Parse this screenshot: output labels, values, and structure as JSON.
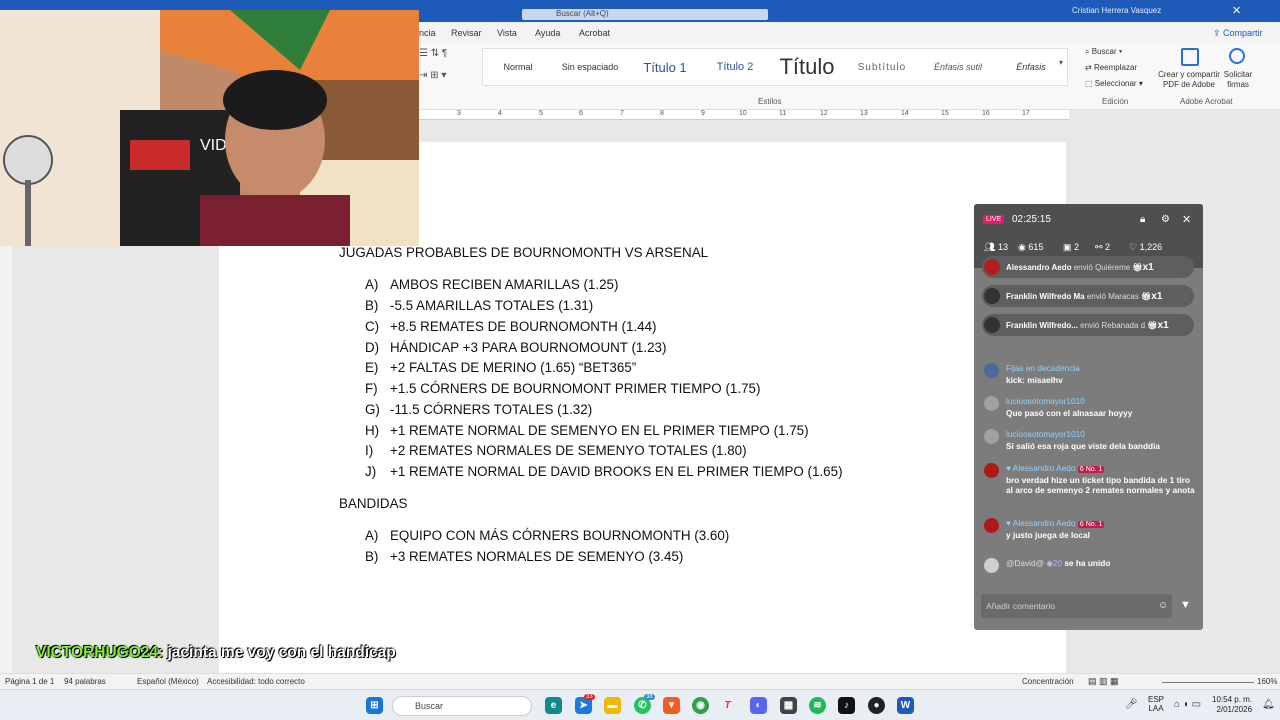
{
  "titlebar": {
    "search": "Buscar (Alt+Q)",
    "user": "Cristian Herrera Vasquez",
    "close": "✕"
  },
  "ribbon": {
    "tabs": [
      "ncia",
      "Revisar",
      "Vista",
      "Ayuda",
      "Acrobat"
    ],
    "share": "Compartir",
    "styles": [
      "Normal",
      "Sin espaciado",
      "Título 1",
      "Título 2",
      "Título",
      "Subtítulo",
      "Énfasis sutil",
      "Énfasis"
    ],
    "styles_label": "Estilos",
    "edit": {
      "find": "Buscar",
      "replace": "Reemplazar",
      "select": "Seleccionar",
      "label": "Edición"
    },
    "adobe": {
      "create": "Crear y compartir PDF de Adobe",
      "request": "Solicitar firmas",
      "label": "Adobe Acrobat"
    }
  },
  "ruler_numbers": [
    "3",
    "4",
    "5",
    "6",
    "7",
    "8",
    "9",
    "10",
    "11",
    "12",
    "13",
    "14",
    "15",
    "16",
    "17"
  ],
  "doc": {
    "heading": "JUGADAS PROBABLES DE BOURNOMONTH VS ARSENAL",
    "items": [
      {
        "letter": "A)",
        "text": "AMBOS RECIBEN AMARILLAS (1.25)"
      },
      {
        "letter": "B)",
        "text": "-5.5 AMARILLAS TOTALES (1.31)"
      },
      {
        "letter": "C)",
        "text": "+8.5 REMATES DE BOURNOMONTH (1.44)"
      },
      {
        "letter": "D)",
        "text": "HÁNDICAP +3 PARA BOURNOMOUNT (1.23)"
      },
      {
        "letter": "E)",
        "text": "+2 FALTAS DE MERINO (1.65) “BET365”"
      },
      {
        "letter": "F)",
        "text": "+1.5 CÓRNERS DE BOURNOMONT PRIMER TIEMPO (1.75)"
      },
      {
        "letter": "G)",
        "text": "-11.5 CÓRNERS TOTALES (1.32)"
      },
      {
        "letter": "H)",
        "text": "+1 REMATE NORMAL DE SEMENYO EN EL PRIMER TIEMPO (1.75)"
      },
      {
        "letter": "I)",
        "text": "+2 REMATES NORMALES DE SEMENYO TOTALES (1.80)"
      },
      {
        "letter": "J)",
        "text": "+1 REMATE NORMAL DE DAVID BROOKS EN EL PRIMER TIEMPO (1.65)"
      }
    ],
    "heading2": "BANDIDAS",
    "items2": [
      {
        "letter": "A)",
        "text": "EQUIPO CON MÁS CÓRNERS BOURNOMONTH (3.60)"
      },
      {
        "letter": "B)",
        "text": "+3 REMATES NORMALES DE SEMENYO (3.45)"
      }
    ]
  },
  "webcam": {
    "chair_text": "VID"
  },
  "live": {
    "badge": "LIVE",
    "time": "02:25:15",
    "stats": [
      "13",
      "615",
      "2",
      "2",
      "1,226"
    ],
    "gifts": [
      {
        "name": "Alessandro Aedo",
        "action": "envió Quiéreme",
        "count": "x1"
      },
      {
        "name": "Franklin Wilfredo Ma",
        "action": "envió Maracas",
        "count": "x1"
      },
      {
        "name": "Franklin Wilfredo...",
        "action": "envió Rebanada d",
        "count": "x1"
      }
    ],
    "chats": [
      {
        "name": "Fijas en decadencia",
        "msg": "kick: misaelhv"
      },
      {
        "name": "lucioosotomayor1010",
        "msg": "Que pasó con el alnasaar hoyyy"
      },
      {
        "name": "lucioosotomayor1010",
        "msg": "Si salió esa roja que viste dela banddia"
      },
      {
        "name": "Alessandro Aedo",
        "badge": "No. 1",
        "badge_num": "6",
        "msg": "bro verdad hize un ticket tipo bandida de 1 tiro al arco de semenyo 2 remates normales y anota"
      },
      {
        "name": "Alessandro Aedo",
        "badge": "No. 1",
        "badge_num": "6",
        "msg": "y justo juega de local"
      }
    ],
    "join": {
      "name": "@David@",
      "level": "20",
      "text": "se ha unido"
    },
    "comment_placeholder": "Añadir comentario"
  },
  "overlay": {
    "user": "VICTORHUGO24:",
    "text": "jacinta me voy con el handicap"
  },
  "status": {
    "page": "Página 1 de 1",
    "words": "94 palabras",
    "lang": "Español (México)",
    "access": "Accesibilidad: todo correcto",
    "focus": "Concentración",
    "zoom": "160%"
  },
  "taskbar": {
    "search": "Buscar",
    "lang": "ESP",
    "lang2": "LAA",
    "time": "10:54 p. m.",
    "date": "2/01/2026",
    "badge1": "33",
    "badge2": "38"
  },
  "colors": {
    "accent": "#1e5ab8",
    "overlay_user": "#7cf03a",
    "live_badge": "#e51a6b"
  }
}
